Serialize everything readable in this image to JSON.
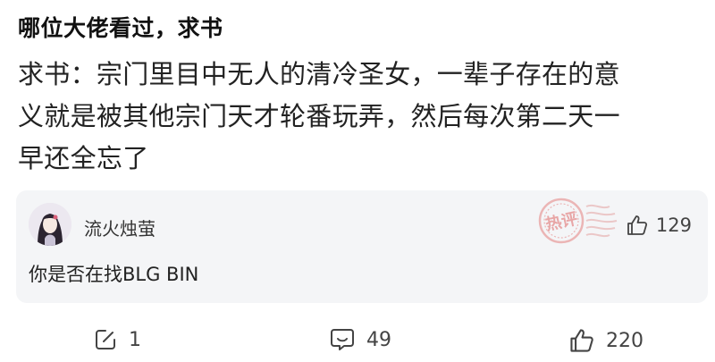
{
  "post": {
    "title": "哪位大佬看过，求书",
    "body_lines": [
      "求书：宗门里目中无人的清冷圣女，一辈子存在的意",
      "义就是被其他宗门天才轮番玩弄，然后每次第二天一",
      "早还全忘了"
    ]
  },
  "comment": {
    "author": "流火烛萤",
    "text": "你是否在找BLG BIN",
    "stamp_text": "热评",
    "likes": "129"
  },
  "footer": {
    "edit_count": "1",
    "comment_count": "49",
    "like_count": "220"
  },
  "colors": {
    "stamp": "#e8a0a0",
    "card_bg": "#f4f5f7"
  }
}
